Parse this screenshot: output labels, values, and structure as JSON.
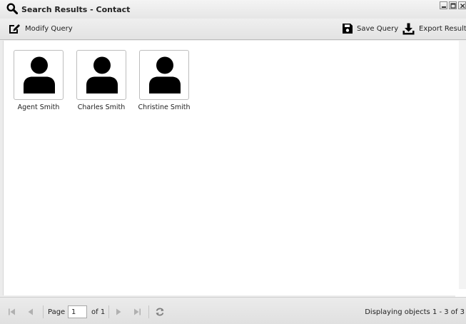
{
  "window": {
    "title": "Search Results - Contact",
    "title_icon": "search-icon",
    "controls": [
      "minimize-icon",
      "maximize-icon",
      "close-icon"
    ]
  },
  "toolbar": {
    "modify_query_label": "Modify Query",
    "modify_query_icon": "edit-icon",
    "save_query_label": "Save Query",
    "save_query_icon": "save-icon",
    "export_results_label": "Export Results",
    "export_results_icon": "download-icon"
  },
  "results": [
    {
      "name": "Agent Smith",
      "icon": "user-icon"
    },
    {
      "name": "Charles Smith",
      "icon": "user-icon"
    },
    {
      "name": "Christine Smith",
      "icon": "user-icon"
    }
  ],
  "paging": {
    "page_label": "Page",
    "page_value": "1",
    "of_label": "of 1",
    "status": "Displaying objects 1 - 3 of 3",
    "icons": [
      "first-page-icon",
      "prev-page-icon",
      "next-page-icon",
      "last-page-icon",
      "refresh-icon"
    ]
  },
  "colors": {
    "background": "#ececec",
    "content": "#ffffff",
    "icon": "#000000",
    "disabled_icon": "#b0b0b0"
  }
}
